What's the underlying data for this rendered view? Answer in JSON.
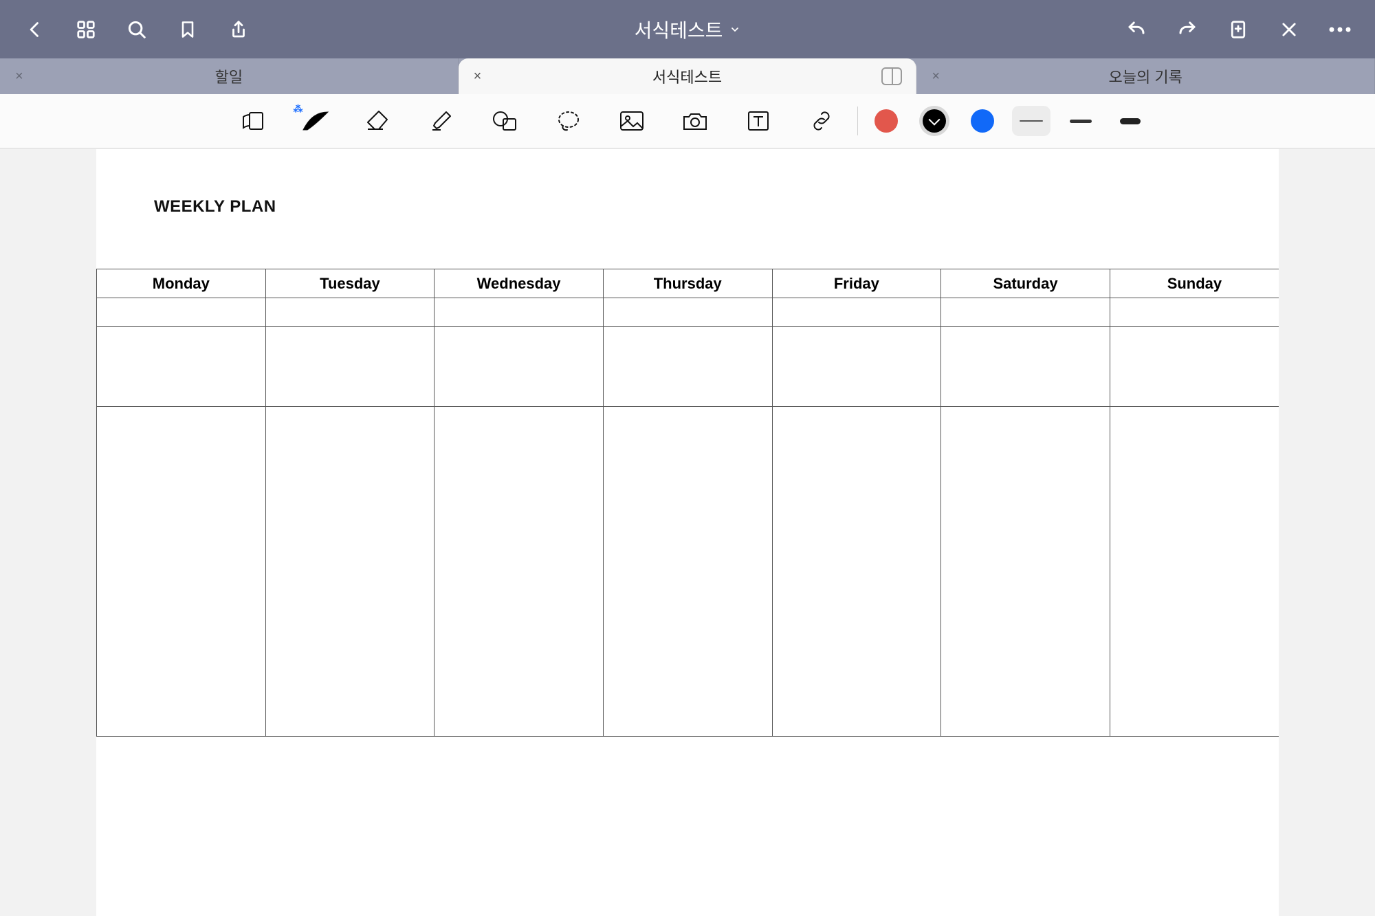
{
  "header": {
    "title": "서식테스트"
  },
  "tabs": [
    {
      "label": "할일",
      "active": false
    },
    {
      "label": "서식테스트",
      "active": true
    },
    {
      "label": "오늘의 기록",
      "active": false
    }
  ],
  "tool_icons": {
    "read": "read-mode-icon",
    "pen": "pen-icon",
    "eraser": "eraser-icon",
    "marker": "highlighter-icon",
    "shape": "shape-icon",
    "lasso": "lasso-icon",
    "image": "image-icon",
    "camera": "camera-icon",
    "text": "text-icon",
    "link": "link-icon"
  },
  "colors": {
    "red": "#e2574c",
    "black": "#000000",
    "blue": "#1169f8"
  },
  "document": {
    "title": "WEEKLY PLAN",
    "days": [
      "Monday",
      "Tuesday",
      "Wednesday",
      "Thursday",
      "Friday",
      "Saturday",
      "Sunday"
    ]
  }
}
